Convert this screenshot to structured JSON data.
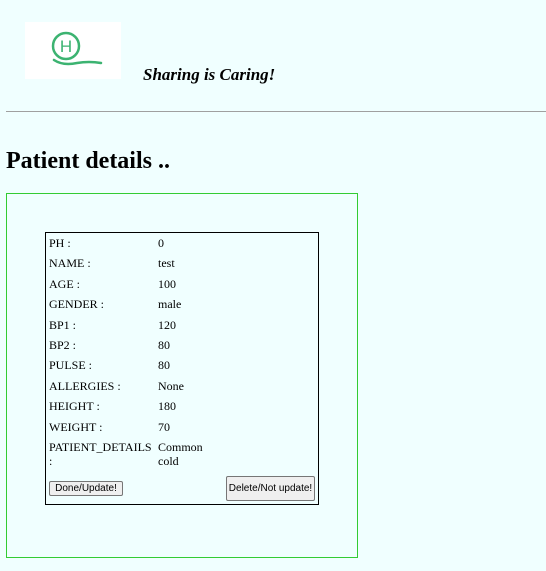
{
  "header": {
    "logo_icon": "hospital-h-icon",
    "logo_letter": "H",
    "logo_color": "#3cb371",
    "tagline": "Sharing is Caring!"
  },
  "page_title": "Patient details ..",
  "patient": {
    "rows": [
      {
        "label": "PH :",
        "value": "0"
      },
      {
        "label": "NAME :",
        "value": "test"
      },
      {
        "label": "AGE :",
        "value": "100"
      },
      {
        "label": "GENDER :",
        "value": "male"
      },
      {
        "label": "BP1 :",
        "value": "120"
      },
      {
        "label": "BP2 :",
        "value": "80"
      },
      {
        "label": "PULSE :",
        "value": "80"
      },
      {
        "label": "ALLERGIES :",
        "value": "None"
      },
      {
        "label": "HEIGHT :",
        "value": "180"
      },
      {
        "label": "WEIGHT :",
        "value": "70"
      },
      {
        "label": "PATIENT_DETAILS :",
        "value": "Common cold"
      }
    ]
  },
  "actions": {
    "done_label": "Done/Update!",
    "delete_label": "Delete/Not update!"
  },
  "colors": {
    "background": "#f0ffff",
    "panel_border": "#33cc33"
  }
}
